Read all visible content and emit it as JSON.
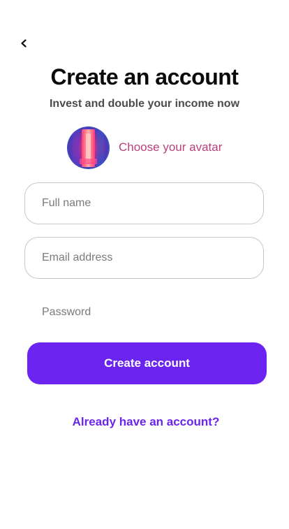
{
  "header": {
    "back_icon": "chevron-left-icon",
    "title": "Create an account",
    "subtitle": "Invest and double your income now"
  },
  "avatar": {
    "label": "Choose your avatar",
    "accent_color": "#b8407d"
  },
  "form": {
    "full_name": {
      "placeholder": "Full name",
      "value": ""
    },
    "email": {
      "placeholder": "Email address",
      "value": ""
    },
    "password": {
      "placeholder": "Password",
      "value": ""
    }
  },
  "actions": {
    "create_label": "Create account",
    "login_link": "Already have an account?",
    "primary_color": "#6b24ef"
  }
}
